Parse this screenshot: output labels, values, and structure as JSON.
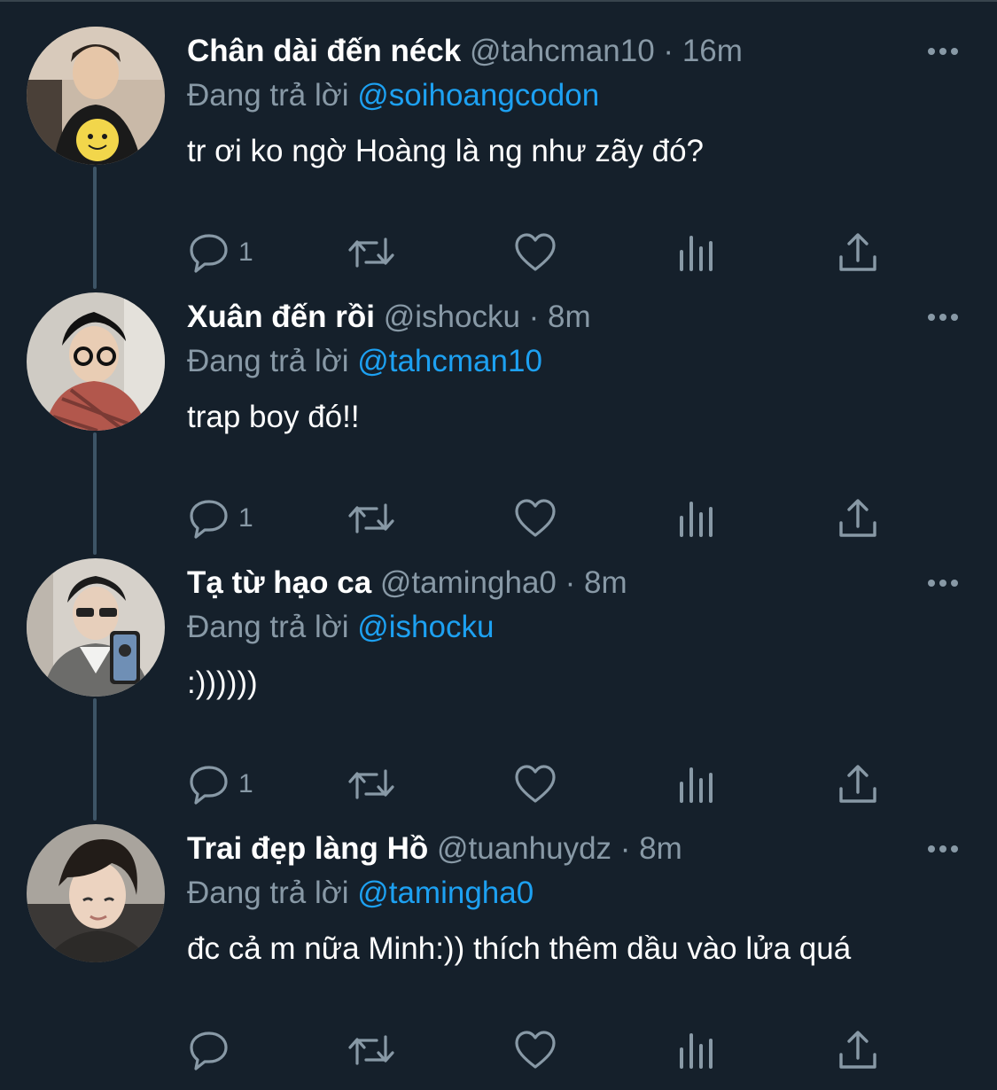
{
  "colors": {
    "background": "#15202b",
    "muted": "#8899a6",
    "link": "#1da1f2",
    "thread_line": "#3d5466"
  },
  "icons": {
    "reply": "reply-icon",
    "retweet": "retweet-icon",
    "like": "heart-icon",
    "analytics": "analytics-icon",
    "share": "share-icon",
    "more": "more-icon"
  },
  "tweets": [
    {
      "name": "Chân dài đến néck",
      "handle": "@tahcman10",
      "time": "16m",
      "replying_label": "Đang trả lời",
      "replying_to": "@soihoangcodon",
      "text": "tr ơi ko ngờ Hoàng là ng như zãy đó?",
      "reply_count": "1"
    },
    {
      "name": "Xuân đến rồi",
      "handle": "@ishocku",
      "time": "8m",
      "replying_label": "Đang trả lời",
      "replying_to": "@tahcman10",
      "text": "trap boy đó!!",
      "reply_count": "1"
    },
    {
      "name": "Tạ từ hạo ca",
      "handle": "@tamingha0",
      "time": "8m",
      "replying_label": "Đang trả lời",
      "replying_to": "@ishocku",
      "text": ":))))))",
      "reply_count": "1"
    },
    {
      "name": "Trai đẹp làng Hồ",
      "handle": "@tuanhuydz",
      "time": "8m",
      "replying_label": "Đang trả lời",
      "replying_to": "@tamingha0",
      "text": "đc cả m nữa Minh:)) thích thêm dầu vào lửa quá",
      "reply_count": ""
    }
  ]
}
